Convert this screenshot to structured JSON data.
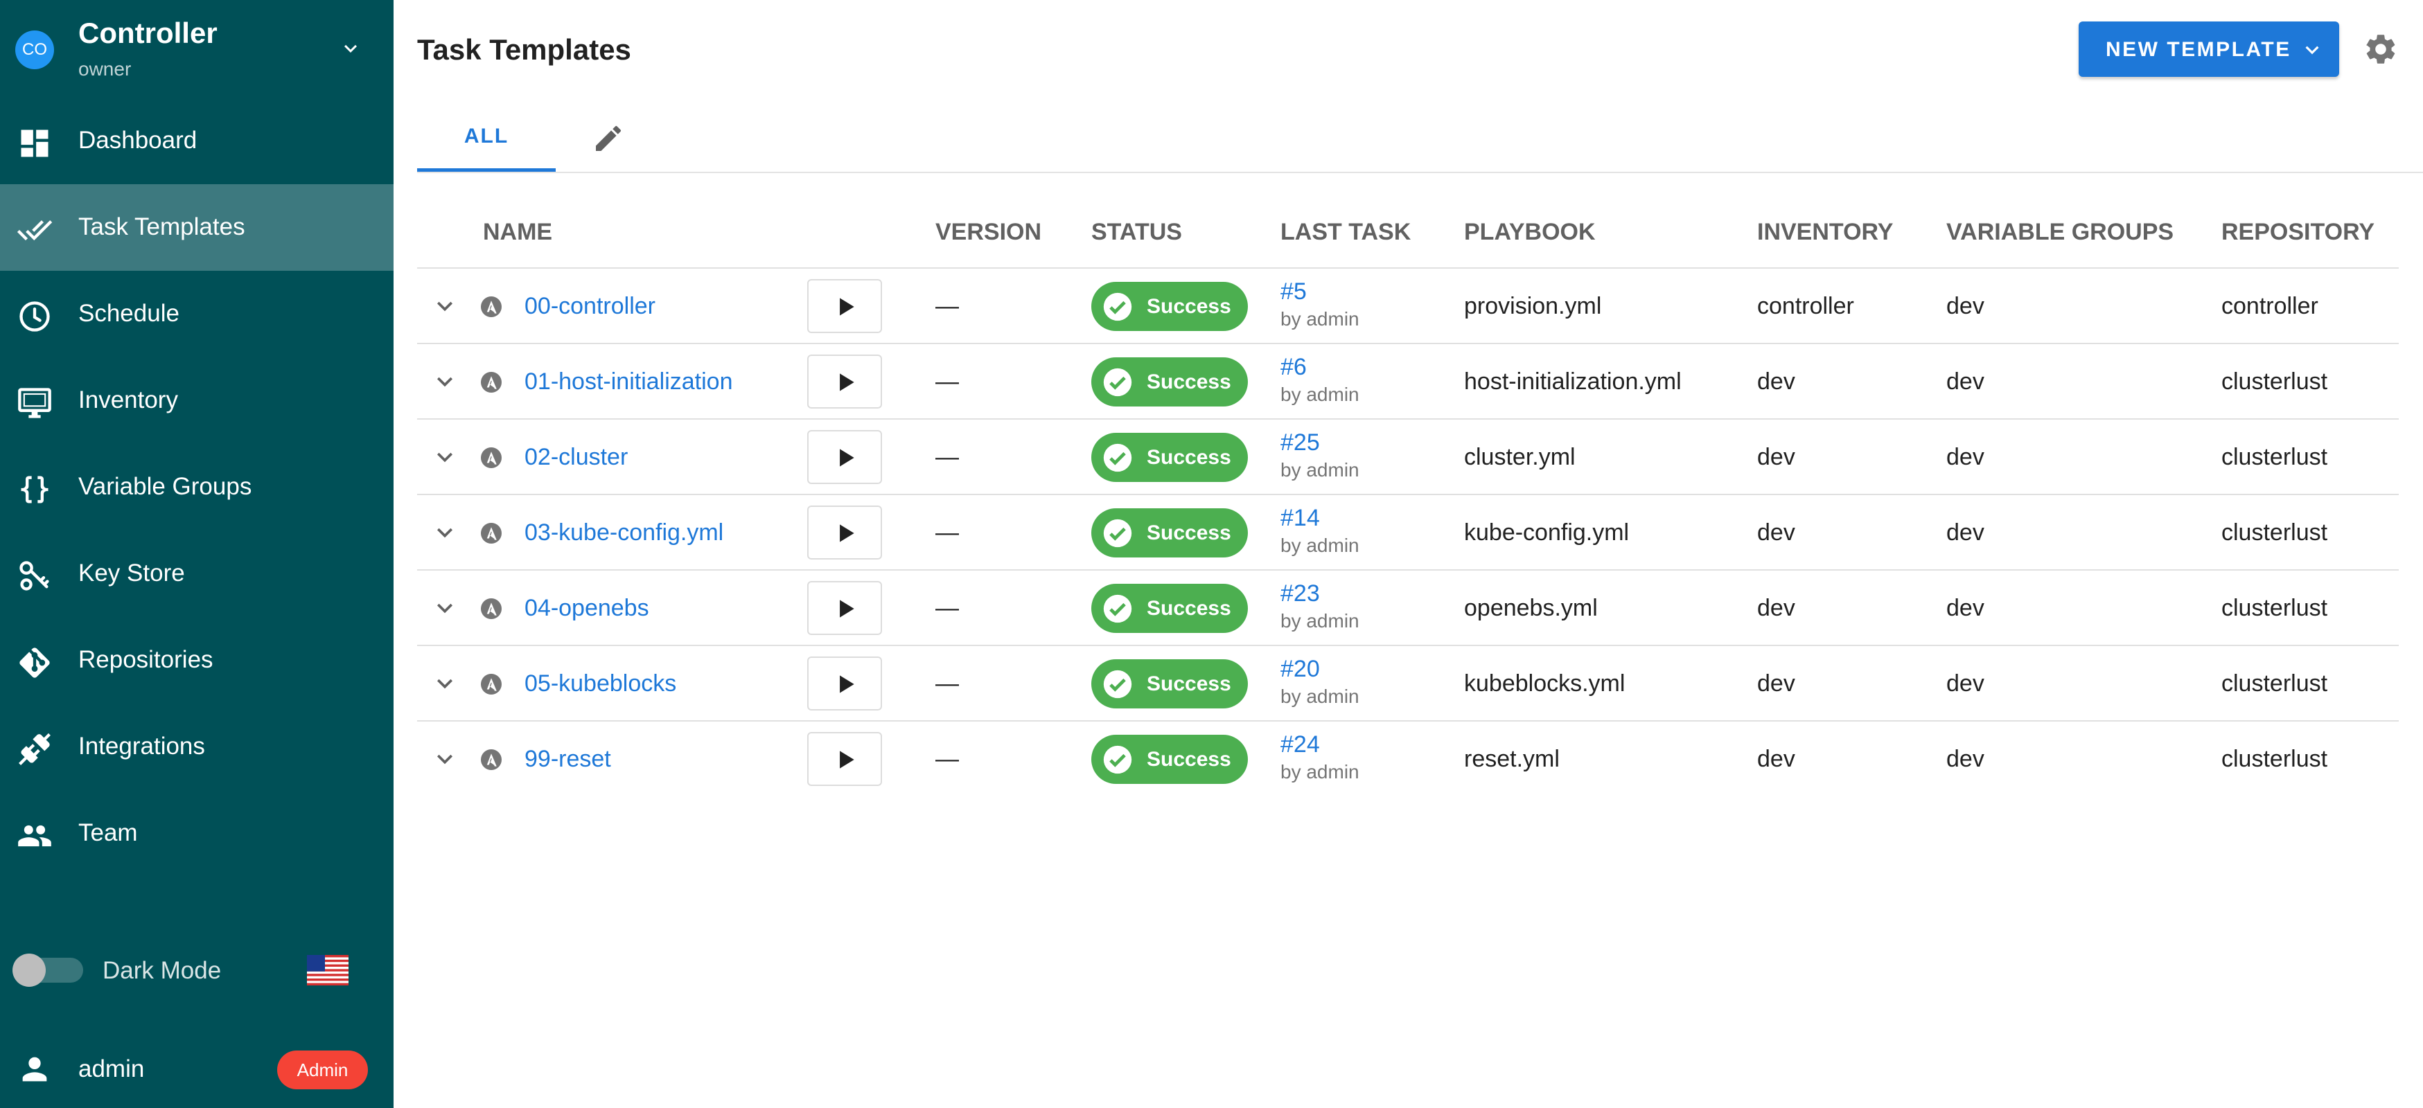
{
  "project": {
    "avatar_initials": "CO",
    "name": "Controller",
    "role": "owner"
  },
  "sidebar": {
    "items": [
      {
        "label": "Dashboard",
        "icon": "dashboard-icon",
        "active": false
      },
      {
        "label": "Task Templates",
        "icon": "done-all-icon",
        "active": true
      },
      {
        "label": "Schedule",
        "icon": "clock-icon",
        "active": false
      },
      {
        "label": "Inventory",
        "icon": "monitor-icon",
        "active": false
      },
      {
        "label": "Variable Groups",
        "icon": "code-braces-icon",
        "active": false
      },
      {
        "label": "Key Store",
        "icon": "key-icon",
        "active": false
      },
      {
        "label": "Repositories",
        "icon": "git-icon",
        "active": false
      },
      {
        "label": "Integrations",
        "icon": "plug-icon",
        "active": false
      },
      {
        "label": "Team",
        "icon": "account-multiple-icon",
        "active": false
      }
    ],
    "dark_mode_label": "Dark Mode",
    "dark_mode_on": false,
    "language_flag": "us-flag-icon",
    "user": {
      "name": "admin",
      "badge": "Admin"
    }
  },
  "colors": {
    "sidebar_bg": "#005057",
    "accent": "#1e78d8",
    "success": "#4caf50",
    "admin_badge": "#f44336"
  },
  "header": {
    "title": "Task Templates",
    "new_template_label": "NEW TEMPLATE"
  },
  "tabs": {
    "all_label": "ALL"
  },
  "table": {
    "columns": {
      "name": "NAME",
      "version": "VERSION",
      "status": "STATUS",
      "last_task": "LAST TASK",
      "playbook": "PLAYBOOK",
      "inventory": "INVENTORY",
      "variable_groups": "VARIABLE GROUPS",
      "repository": "REPOSITORY"
    },
    "rows": [
      {
        "name": "00-controller",
        "version": "—",
        "status": "Success",
        "task": "#5",
        "by": "by admin",
        "playbook": "provision.yml",
        "inventory": "controller",
        "variable_group": "dev",
        "repository": "controller"
      },
      {
        "name": "01-host-initialization",
        "version": "—",
        "status": "Success",
        "task": "#6",
        "by": "by admin",
        "playbook": "host-initialization.yml",
        "inventory": "dev",
        "variable_group": "dev",
        "repository": "clusterlust"
      },
      {
        "name": "02-cluster",
        "version": "—",
        "status": "Success",
        "task": "#25",
        "by": "by admin",
        "playbook": "cluster.yml",
        "inventory": "dev",
        "variable_group": "dev",
        "repository": "clusterlust"
      },
      {
        "name": "03-kube-config.yml",
        "version": "—",
        "status": "Success",
        "task": "#14",
        "by": "by admin",
        "playbook": "kube-config.yml",
        "inventory": "dev",
        "variable_group": "dev",
        "repository": "clusterlust"
      },
      {
        "name": "04-openebs",
        "version": "—",
        "status": "Success",
        "task": "#23",
        "by": "by admin",
        "playbook": "openebs.yml",
        "inventory": "dev",
        "variable_group": "dev",
        "repository": "clusterlust"
      },
      {
        "name": "05-kubeblocks",
        "version": "—",
        "status": "Success",
        "task": "#20",
        "by": "by admin",
        "playbook": "kubeblocks.yml",
        "inventory": "dev",
        "variable_group": "dev",
        "repository": "clusterlust"
      },
      {
        "name": "99-reset",
        "version": "—",
        "status": "Success",
        "task": "#24",
        "by": "by admin",
        "playbook": "reset.yml",
        "inventory": "dev",
        "variable_group": "dev",
        "repository": "clusterlust"
      }
    ]
  }
}
